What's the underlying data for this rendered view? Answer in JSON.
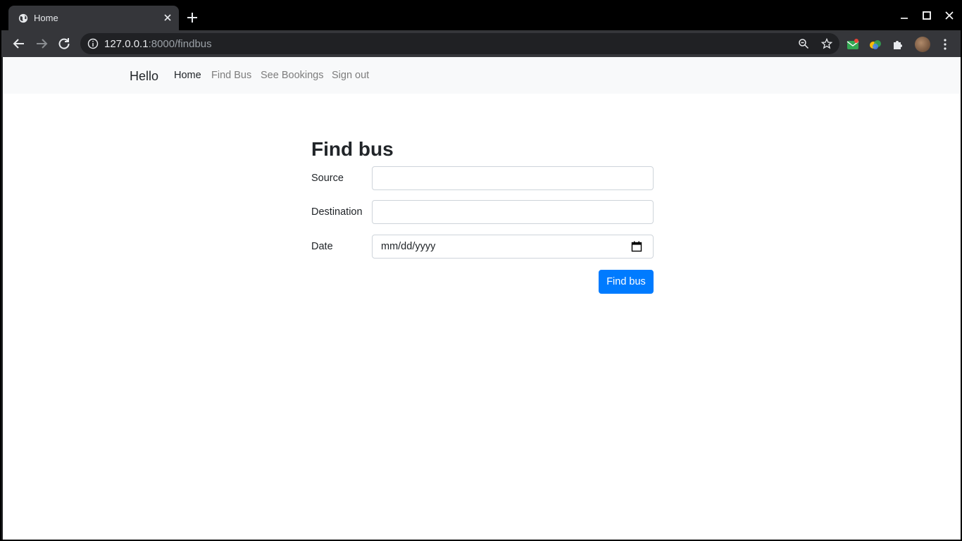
{
  "browser": {
    "tab_title": "Home",
    "url_host": "127.0.0.1",
    "url_rest": ":8000/findbus"
  },
  "navbar": {
    "brand": "Hello",
    "links": [
      "Home",
      "Find Bus",
      "See Bookings",
      "Sign out"
    ]
  },
  "form": {
    "title": "Find bus",
    "source_label": "Source",
    "source_value": "",
    "destination_label": "Destination",
    "destination_value": "",
    "date_label": "Date",
    "date_placeholder": "mm/dd/yyyy",
    "submit_label": "Find bus"
  },
  "colors": {
    "primary": "#007bff",
    "navbar_bg": "#f8f9fa",
    "chrome_dark": "#35363a"
  }
}
